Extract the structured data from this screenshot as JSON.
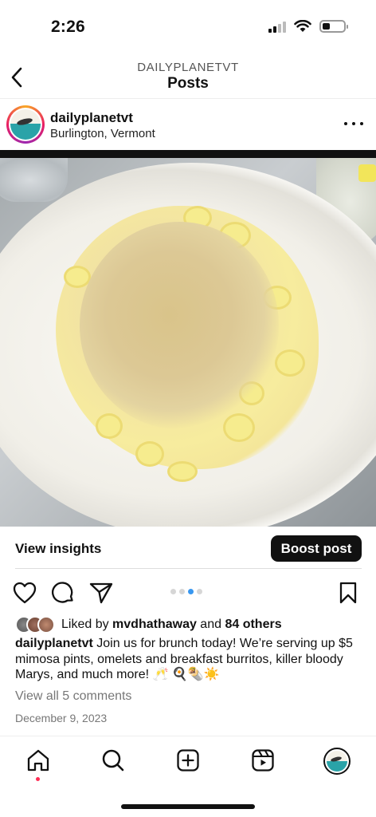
{
  "status_bar": {
    "time": "2:26"
  },
  "header": {
    "account": "DAILYPLANETVT",
    "title": "Posts"
  },
  "post": {
    "username": "dailyplanetvt",
    "location": "Burlington, Vermont",
    "image_alt": "Bowl of mac and cheese with toasted breadcrumbs",
    "carousel": {
      "count": 4,
      "active": 3
    }
  },
  "insights": {
    "view_label": "View insights",
    "boost_label": "Boost post"
  },
  "likes": {
    "prefix": "Liked by ",
    "user": "mvdhathaway",
    "middle": " and ",
    "others": "84 others"
  },
  "caption": {
    "username": "dailyplanetvt",
    "text": " Join us for brunch today! We’re serving up $5 mimosa pints, omelets and breakfast burritos, killer bloody Marys, and much more! 🥂 🍳🌯☀️"
  },
  "comments_link": "View all 5 comments",
  "date": "December 9, 2023",
  "colors": {
    "accent": "#3897f0",
    "notification": "#ff2d55",
    "text": "#111111",
    "muted": "#777777"
  },
  "icons": {
    "back": "chevron-left-icon",
    "more": "more-horizontal-icon",
    "like": "heart-icon",
    "comment": "comment-icon",
    "share": "send-icon",
    "save": "bookmark-icon",
    "home": "home-icon",
    "search": "search-icon",
    "create": "plus-square-icon",
    "reels": "reels-icon"
  }
}
